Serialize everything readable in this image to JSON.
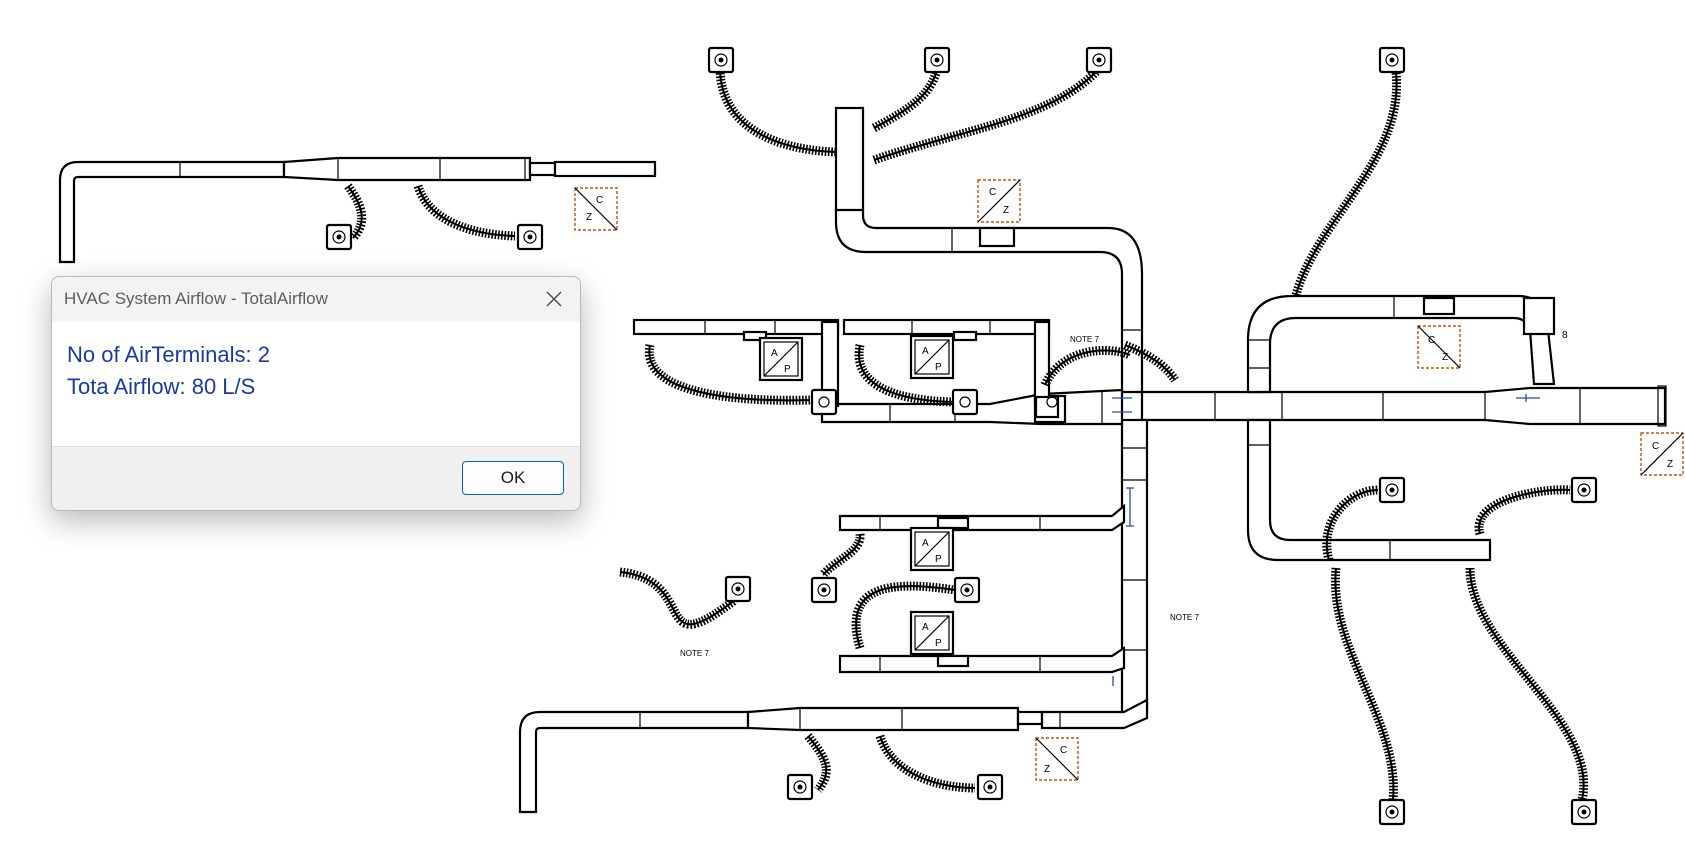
{
  "dialog": {
    "title": "HVAC System Airflow - TotalAirflow",
    "close_icon": "close-icon",
    "lines": [
      "No of AirTerminals: 2",
      "Tota Airflow: 80 L/S"
    ],
    "ok_label": "OK",
    "accent_color": "#0067c0",
    "message_color": "#1a3b9e"
  },
  "drawing": {
    "notes": [
      "NOTE 7",
      "NOTE 7",
      "NOTE 7"
    ],
    "unit_tags": [
      {
        "top": "A",
        "bottom": "P"
      },
      {
        "top": "A",
        "bottom": "P"
      },
      {
        "top": "A",
        "bottom": "P"
      },
      {
        "top": "A",
        "bottom": "P"
      }
    ],
    "zone_tags": [
      {
        "top": "C",
        "bottom": "Z"
      },
      {
        "top": "C",
        "bottom": "Z"
      },
      {
        "top": "C",
        "bottom": "Z"
      },
      {
        "top": "C",
        "bottom": "Z"
      },
      {
        "top": "C",
        "bottom": "Z"
      }
    ],
    "colors": {
      "duct": "#000000",
      "zone_tag": "#c5500f",
      "dimension": "#1e4fa8"
    }
  }
}
